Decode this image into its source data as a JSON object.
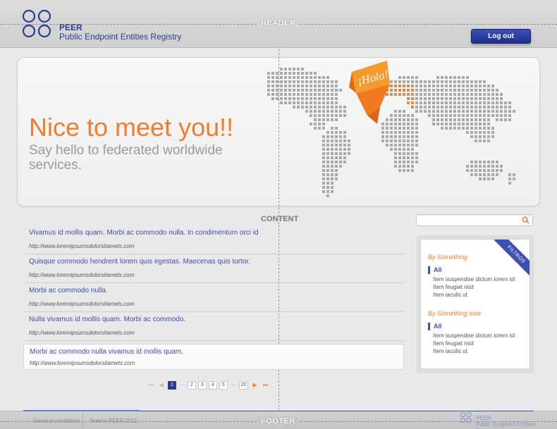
{
  "header": {
    "guide_label": "HEADER",
    "brand_title": "PEER",
    "brand_subtitle": "Public Endpoint Entities Registry",
    "logout_label": "Log out"
  },
  "hero": {
    "title": "Nice to meet you!!",
    "subtitle": "Say hello to federated worldwide services.",
    "badge_text": "¡Hola!"
  },
  "content": {
    "guide_label": "CONTENT",
    "results": [
      {
        "title": "Vivamus id mollis quam. Morbi ac commodo nulla. In condimentum orci id",
        "url": "http://www.loremipsumsdolorsitamets.com"
      },
      {
        "title": "Quisque commodo hendrerit lorem quis egestas. Maecenas quis tortor.",
        "url": "http://www.loremipsumsdolorsitamets.com"
      },
      {
        "title": "Morbi ac commodo nulla.",
        "url": "http://www.loremipsumsdolorsitamets.com"
      },
      {
        "title": "Nulla vivamus id mollis quam. Morbi ac commodo.",
        "url": "http://www.loremipsumsdolorsitamets.com"
      },
      {
        "title": "Morbi ac commodo nulla vivamus id mollis quam.",
        "url": "http://www.loremipsumsdolorsitamets.com"
      }
    ],
    "pagination": {
      "pages": [
        "1",
        "2",
        "3",
        "4",
        "5"
      ],
      "ellipsis": "...",
      "last_page": "20",
      "current": "1"
    }
  },
  "search": {
    "placeholder": "",
    "icon": "search-icon"
  },
  "filters": {
    "ribbon_label": "FILTROS",
    "groups": [
      {
        "heading": "By Something",
        "all_label": "All",
        "items": [
          "Item suspendise dictum lorem sit",
          "Item feugiat nisit",
          "Item iaculis ut"
        ]
      },
      {
        "heading": "By Something else",
        "all_label": "All",
        "items": [
          "Item suspendise dictum lorem sit",
          "Item feugiat nisit",
          "Item iaculis ut"
        ]
      }
    ]
  },
  "footer": {
    "guide_label": "FOOTER",
    "links": [
      "General conditions",
      "Terena PEER 2011"
    ],
    "brand_title": "PEER",
    "brand_subtitle": "Public Endpoint Entities Registry"
  },
  "colors": {
    "accent_orange": "#f07d2f",
    "brand_blue": "#2b3d8f",
    "link_blue": "#3d4fb1"
  }
}
